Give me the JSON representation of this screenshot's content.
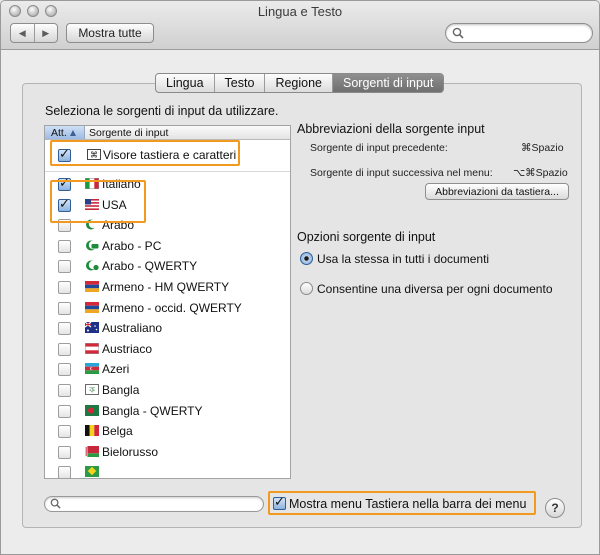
{
  "window": {
    "title": "Lingua e Testo"
  },
  "toolbar": {
    "show_all": "Mostra tutte",
    "search_placeholder": ""
  },
  "tabs": [
    {
      "label": "Lingua",
      "active": false
    },
    {
      "label": "Testo",
      "active": false
    },
    {
      "label": "Regione",
      "active": false
    },
    {
      "label": "Sorgenti di input",
      "active": true
    }
  ],
  "input_sources": {
    "heading": "Seleziona le sorgenti di input da utilizzare.",
    "columns": {
      "enabled": "Att.",
      "source": "Sorgente di input"
    },
    "viewer": {
      "label": "Visore tastiera e caratteri",
      "checked": true,
      "icon": "keyboard-viewer-icon"
    },
    "items": [
      {
        "label": "Italiano",
        "checked": true,
        "icon": "flag-italy-icon"
      },
      {
        "label": "USA",
        "checked": true,
        "icon": "flag-usa-icon"
      },
      {
        "label": "Arabo",
        "checked": false,
        "icon": "crescent-icon"
      },
      {
        "label": "Arabo - PC",
        "checked": false,
        "icon": "crescent-pc-icon"
      },
      {
        "label": "Arabo - QWERTY",
        "checked": false,
        "icon": "crescent-qwerty-icon"
      },
      {
        "label": "Armeno - HM QWERTY",
        "checked": false,
        "icon": "flag-armenia-icon"
      },
      {
        "label": "Armeno - occid. QWERTY",
        "checked": false,
        "icon": "flag-armenia-icon"
      },
      {
        "label": "Australiano",
        "checked": false,
        "icon": "flag-australia-icon"
      },
      {
        "label": "Austriaco",
        "checked": false,
        "icon": "flag-austria-icon"
      },
      {
        "label": "Azeri",
        "checked": false,
        "icon": "flag-azerbaijan-icon"
      },
      {
        "label": "Bangla",
        "checked": false,
        "icon": "bangla-icon"
      },
      {
        "label": "Bangla - QWERTY",
        "checked": false,
        "icon": "flag-bangladesh-icon"
      },
      {
        "label": "Belga",
        "checked": false,
        "icon": "flag-belgium-icon"
      },
      {
        "label": "Bielorusso",
        "checked": false,
        "icon": "flag-belarus-icon"
      }
    ]
  },
  "shortcuts": {
    "title": "Abbreviazioni della sorgente input",
    "prev_label": "Sorgente di input precedente:",
    "prev_keys": "⌘Spazio",
    "next_label": "Sorgente di input successiva nel menu:",
    "next_keys": "⌥⌘Spazio",
    "button": "Abbreviazioni da tastiera..."
  },
  "options": {
    "title": "Opzioni sorgente di input",
    "radio_same": "Usa la stessa in tutti i documenti",
    "radio_diff": "Consentine una diversa per ogni documento",
    "selected": "radio_same"
  },
  "bottom": {
    "search_placeholder": "",
    "show_menu": "Mostra menu Tastiera nella barra dei menu",
    "show_menu_checked": true,
    "help": "?"
  },
  "colors": {
    "highlight": "#f29a1f",
    "selected_tab": "#7c7c7c",
    "checkbox_blue": "#8eb3de"
  }
}
